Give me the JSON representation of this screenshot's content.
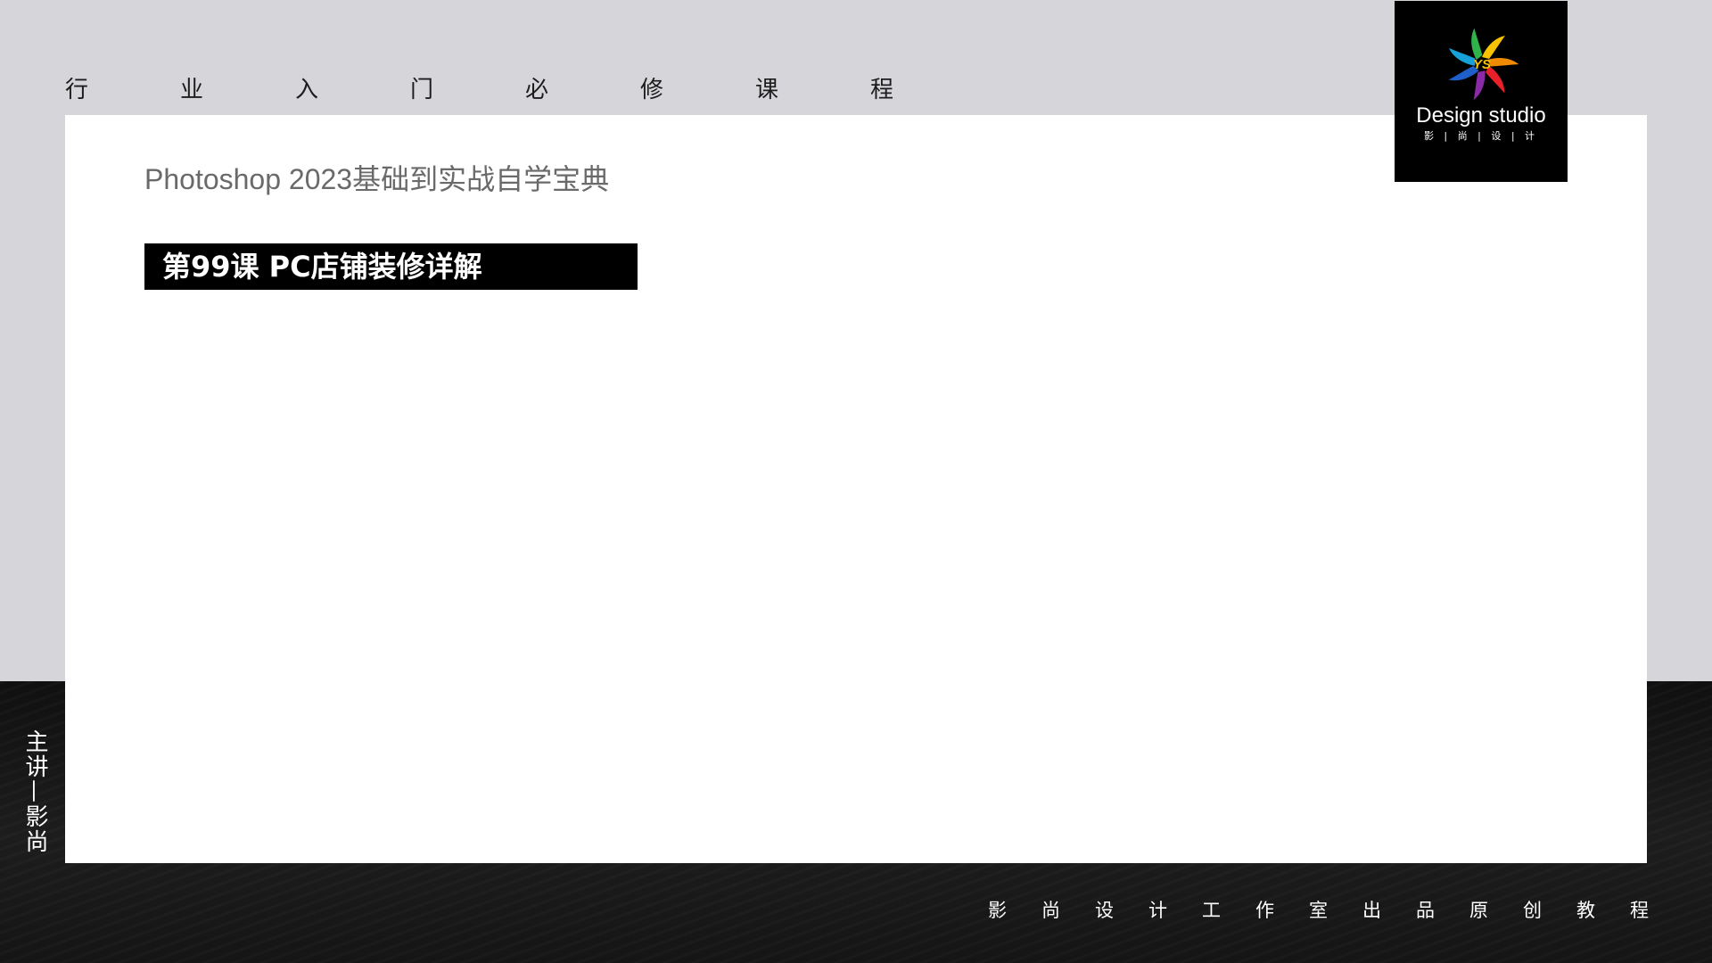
{
  "top_nav": {
    "chars": [
      "行",
      "业",
      "入",
      "门",
      "必",
      "修",
      "课",
      "程"
    ]
  },
  "main": {
    "subtitle": "Photoshop 2023基础到实战自学宝典",
    "lesson_title": "第99课 PC店铺装修详解"
  },
  "logo": {
    "mark_text": "YS",
    "name": "Design studio",
    "sub": "影 | 尚 | 设 | 计"
  },
  "side": {
    "presenter": "主讲—影尚"
  },
  "footer": {
    "chars": [
      "影",
      "尚",
      "设",
      "计",
      "工",
      "作",
      "室",
      "出",
      "品",
      "原",
      "创",
      "教",
      "程"
    ]
  },
  "colors": {
    "page_background": "#d6d5d9",
    "card": "#ffffff",
    "lesson_bar": "#000000",
    "logo_box": "#000000",
    "bottom_band": "#151515"
  }
}
